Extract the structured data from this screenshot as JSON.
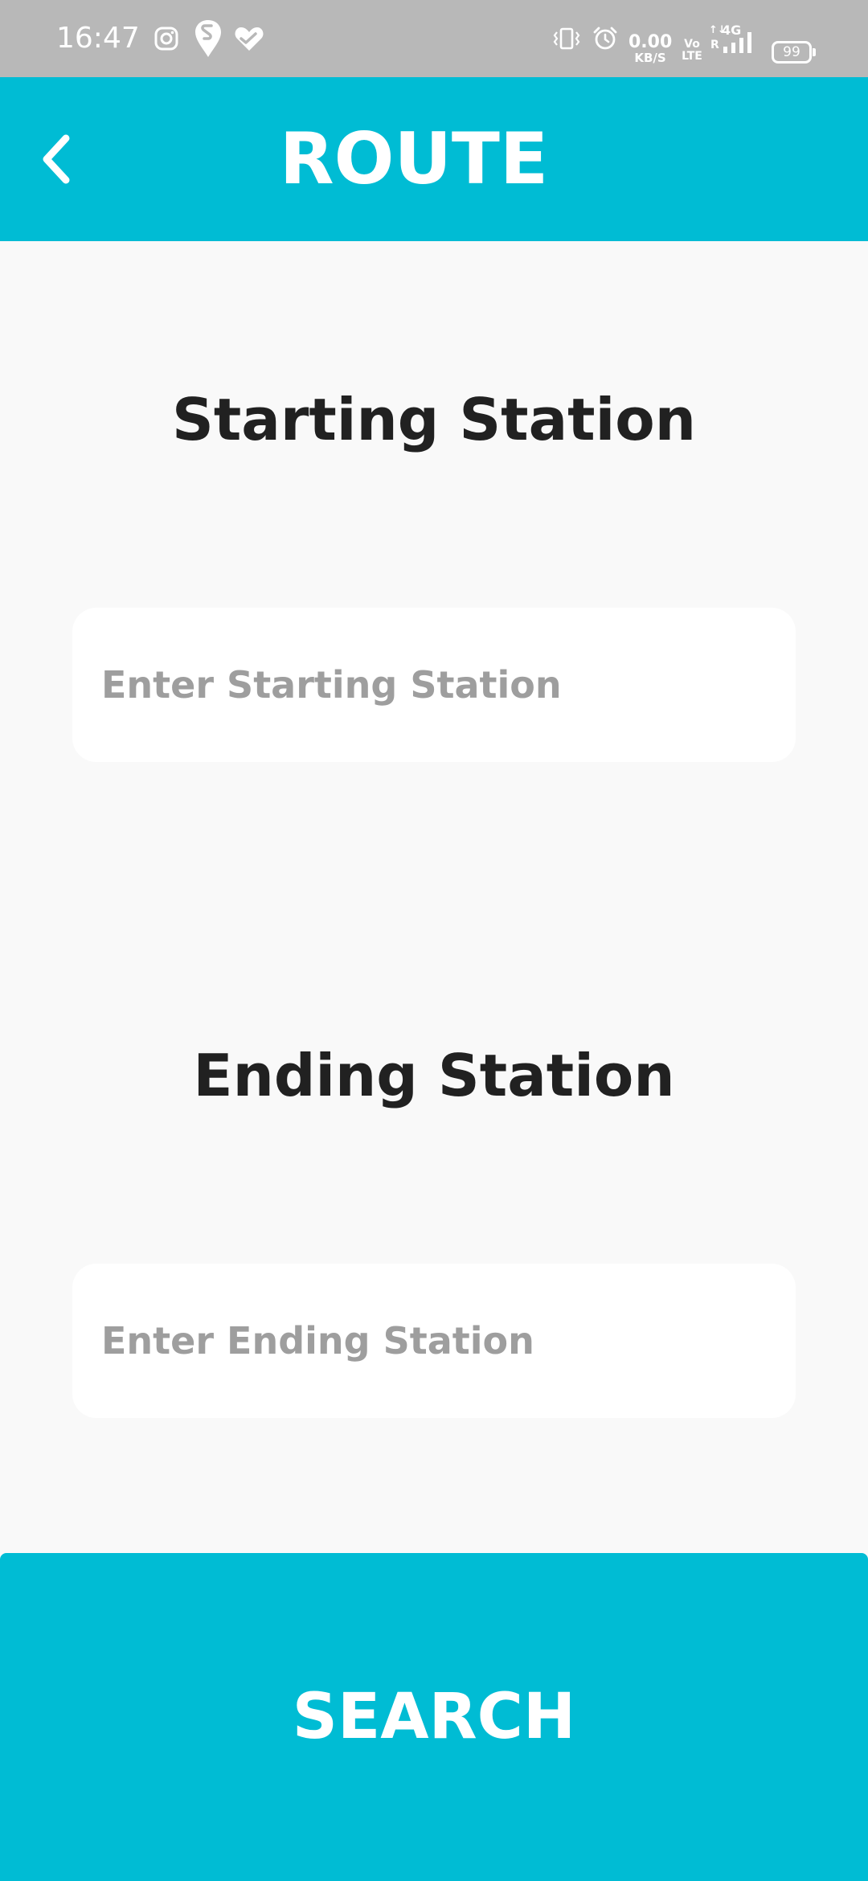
{
  "status_bar": {
    "time": "16:47",
    "net_speed_value": "0.00",
    "net_speed_unit": "KB/S",
    "volte_top": "Vo",
    "volte_bottom": "LTE",
    "network_type": "4G",
    "roaming": "R",
    "battery": "99",
    "icons": [
      "instagram-icon",
      "swiggy-icon",
      "health-heart-icon",
      "vibrate-icon",
      "alarm-icon",
      "signal-icon",
      "battery-icon"
    ]
  },
  "app_bar": {
    "title": "ROUTE",
    "back_icon": "chevron-left-icon"
  },
  "start": {
    "heading": "Starting Station",
    "placeholder": "Enter Starting Station",
    "value": ""
  },
  "end": {
    "heading": "Ending Station",
    "placeholder": "Enter Ending Station",
    "value": ""
  },
  "search_button": {
    "label": "SEARCH"
  },
  "colors": {
    "accent": "#00bcd4",
    "status_bar": "#b8b8b8",
    "background": "#f9f9f9",
    "heading_text": "#212121",
    "placeholder_text": "#9e9e9e",
    "card": "#ffffff"
  }
}
